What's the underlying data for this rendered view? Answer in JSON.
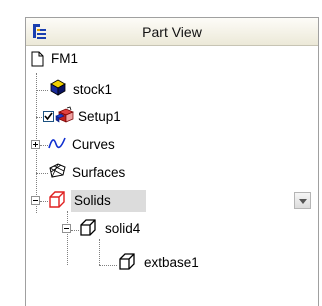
{
  "panel": {
    "title": "Part View"
  },
  "tree": {
    "root": {
      "label": "FM1",
      "icon": "document-icon"
    },
    "items": [
      {
        "label": "stock1",
        "icon": "stock-icon"
      },
      {
        "label": "Setup1",
        "icon": "setup-icon",
        "checked": true
      },
      {
        "label": "Curves",
        "icon": "curves-icon",
        "expanded": false
      },
      {
        "label": "Surfaces",
        "icon": "surfaces-icon"
      },
      {
        "label": "Solids",
        "icon": "solids-icon",
        "expanded": true,
        "selected": true
      },
      {
        "label": "solid4",
        "icon": "solid-icon",
        "expanded": true
      },
      {
        "label": "extbase1",
        "icon": "feature-icon"
      }
    ]
  },
  "colors": {
    "selection": "#dcdcdc",
    "solids_icon": "#e02020",
    "curves_icon": "#1030d0",
    "stock_icon": "#1a2a9a",
    "stock_top": "#f0d000"
  }
}
